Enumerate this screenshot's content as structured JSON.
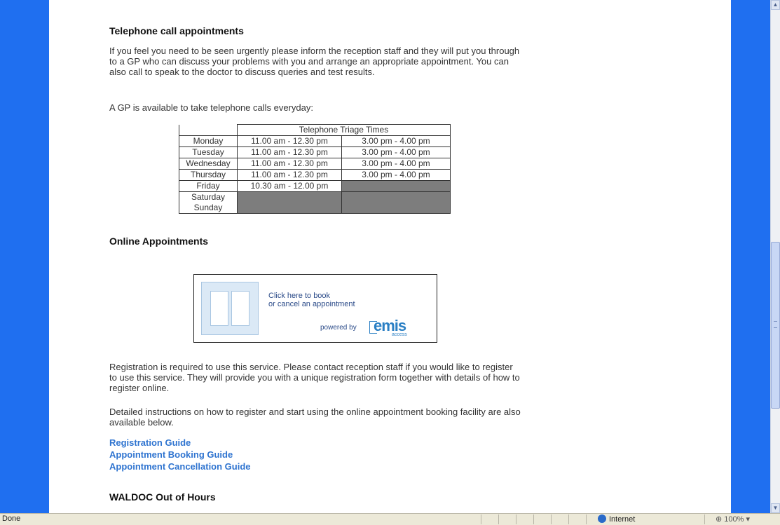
{
  "page": {
    "phone_heading": "Telephone call appointments",
    "phone_para": "If you feel you need to be seen urgently please inform the reception staff and they will put you through to a GP who can discuss your problems with you and arrange an appropriate appointment. You can also call to speak to the doctor to discuss queries and test results.",
    "gp_available": "A GP is available to take telephone calls everyday:",
    "triage": {
      "header": "Telephone Triage Times",
      "rows": [
        {
          "day": "Monday",
          "am": "11.00 am - 12.30 pm",
          "pm": "3.00 pm - 4.00 pm"
        },
        {
          "day": "Tuesday",
          "am": "11.00 am - 12.30 pm",
          "pm": "3.00 pm - 4.00 pm"
        },
        {
          "day": "Wednesday",
          "am": "11.00 am - 12.30 pm",
          "pm": "3.00 pm - 4.00 pm"
        },
        {
          "day": "Thursday",
          "am": "11.00 am - 12.30 pm",
          "pm": "3.00 pm - 4.00 pm"
        },
        {
          "day": "Friday",
          "am": "10.30 am - 12.00 pm",
          "pm": ""
        }
      ],
      "weekend_sat": "Saturday",
      "weekend_sun": "Sunday"
    },
    "online_heading": "Online Appointments",
    "emis_banner": {
      "line1": "Click here to book",
      "line2": "or cancel an appointment",
      "powered_by": "powered by",
      "logo": "emis",
      "logo_sub": "access"
    },
    "registration_para": "Registration is required to use this service. Please contact reception staff if you would like to register to use this service. They will provide you with a unique registration form together with details of how to register online.",
    "instructions_para": "Detailed instructions on how to register and start using the online appointment booking facility are also available below.",
    "links": {
      "registration_guide": "Registration Guide",
      "booking_guide": "Appointment Booking Guide",
      "cancellation_guide": "Appointment Cancellation Guide"
    },
    "waldoc_heading": "WALDOC Out of Hours"
  },
  "statusbar": {
    "status": "Done",
    "zone": "Internet",
    "zoom": "100%"
  },
  "colors": {
    "side_blue": "#1f6ff0",
    "link_blue": "#2f74d0",
    "table_grey": "#7d7d7d"
  }
}
